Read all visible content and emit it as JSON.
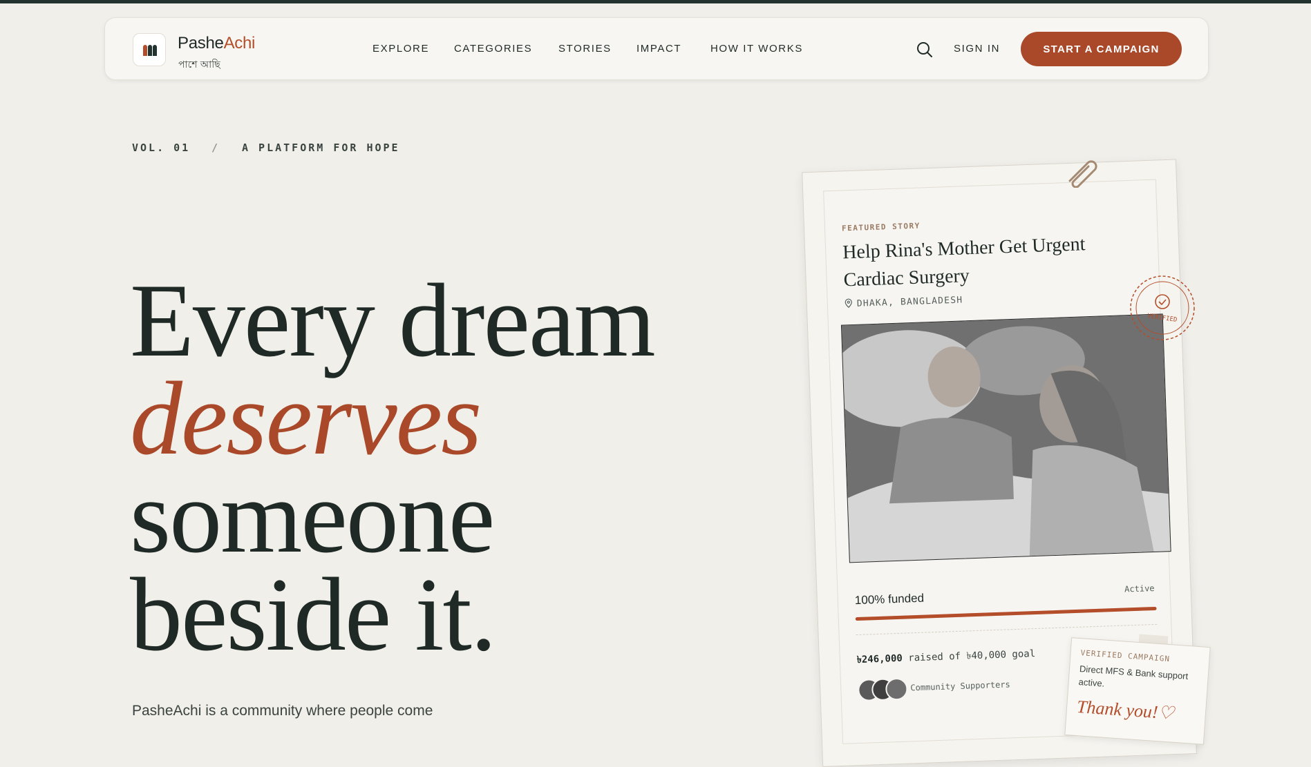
{
  "brand": {
    "name_part1": "Pashe",
    "name_part2": "Achi",
    "subtitle": "পাশে আছি"
  },
  "nav": {
    "items": [
      "EXPLORE",
      "CATEGORIES",
      "STORIES",
      "IMPACT",
      "HOW IT WORKS"
    ],
    "signin": "SIGN IN",
    "cta": "START A CAMPAIGN",
    "search_icon": "search-icon"
  },
  "meta": {
    "volume": "VOL. 01",
    "separator": "/",
    "tagline": "A PLATFORM FOR HOPE"
  },
  "hero": {
    "line1": "Every dream",
    "line2": "deserves",
    "line3": "someone",
    "line4": "beside it."
  },
  "lead": "PasheAchi is a community where people come",
  "card": {
    "tag": "FEATURED STORY",
    "title": "Help Rina's Mother Get Urgent Cardiac Surgery",
    "location": "DHAKA, BANGLADESH",
    "stamp": "VERIFIED",
    "funded_label": "100% funded",
    "status": "Active",
    "progress_fraction": 1.0,
    "raised_amount": "৳246,000",
    "raised_text": "raised of ৳40,000 goal",
    "supporters": "Community Supporters"
  },
  "note": {
    "title": "VERIFIED CAMPAIGN",
    "body": "Direct MFS & Bank support active.",
    "sign": "Thank you!♡"
  },
  "colors": {
    "accent": "#a9492a",
    "ink": "#1f2a27",
    "background": "#f1efea"
  }
}
